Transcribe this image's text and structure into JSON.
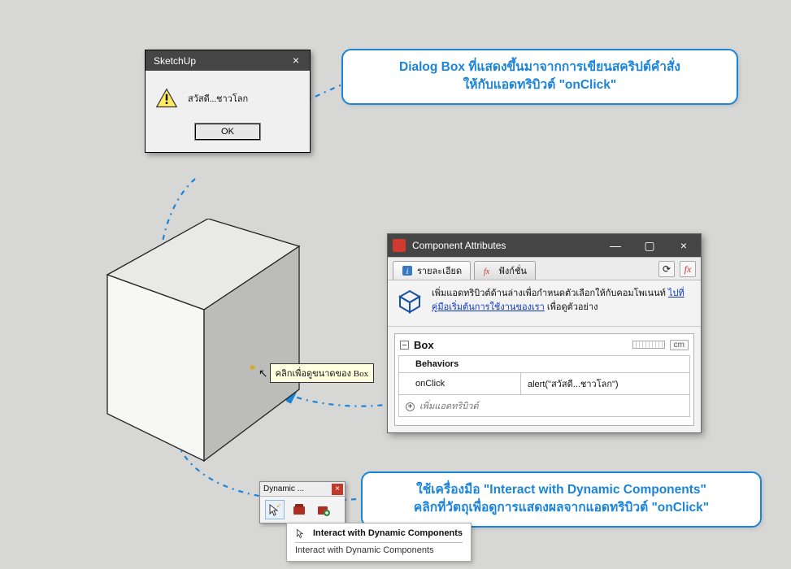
{
  "alert": {
    "title": "SketchUp",
    "message": "สวัสดี...ชาวโลก",
    "ok": "OK"
  },
  "callout1": {
    "line1": "Dialog Box ที่แสดงขึ้นมาจากการเขียนสคริปต์คำสั่ง",
    "line2": "ให้กับแอดทริบิวต์ \"onClick\""
  },
  "callout2": {
    "line1": "ใช้เครื่องมือ \"Interact with Dynamic Components\"",
    "line2": "คลิกที่วัตถุเพื่อดูการแสดงผลจากแอดทริบิวต์ \"onClick\""
  },
  "tooltip_on_cube": "คลิกเพื่อดูขนาดของ Box",
  "attrwin": {
    "title": "Component Attributes",
    "tab_details": "รายละเอียด",
    "tab_functions": "ฟังก์ชั่น",
    "info_text_pre": "เพิ่มแอดทริบิวต์ด้านล่างเพื่อกำหนดตัวเลือกให้กับคอมโพเนนท์ ",
    "info_link": "ไปที่คู่มือเริ่มต้นการใช้งานของเรา",
    "info_text_post": " เพื่อดูตัวอย่าง",
    "box_name": "Box",
    "unit": "cm",
    "section": "Behaviors",
    "attr_name": "onClick",
    "attr_value": "alert(\"สวัสดี...ชาวโลก\")",
    "add_attr": "เพิ่มแอดทริบิวต์"
  },
  "dyn_toolbar": {
    "title": "Dynamic ...",
    "tooltip_title": "Interact with Dynamic Components",
    "tooltip_body": "Interact with Dynamic Components"
  }
}
